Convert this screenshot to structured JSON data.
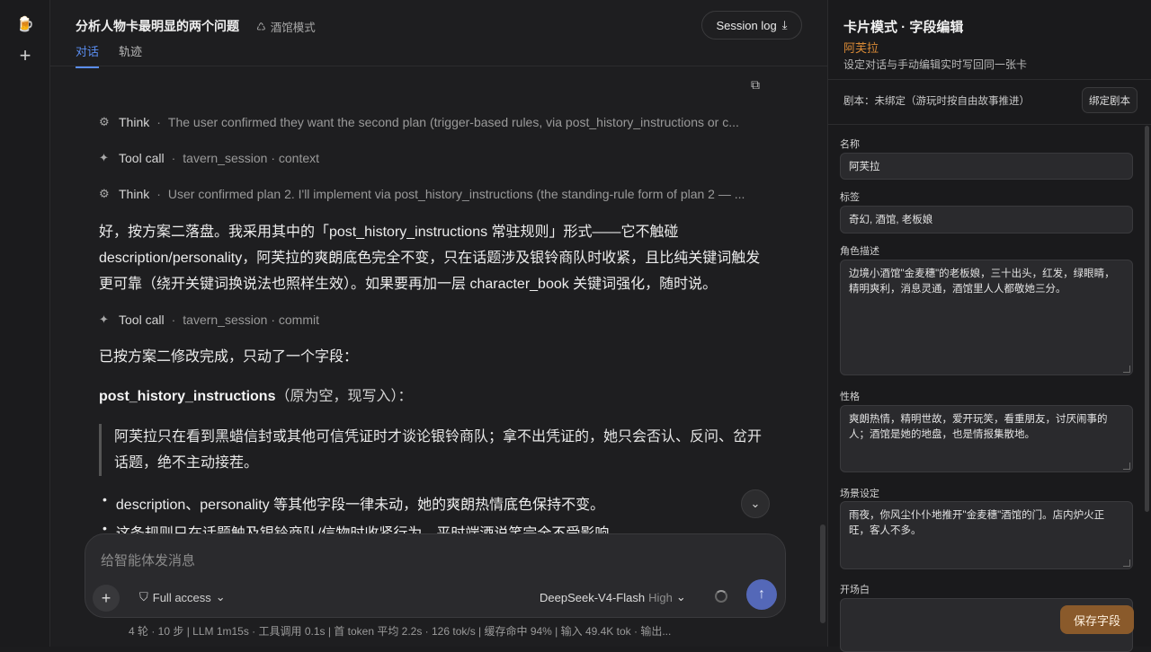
{
  "sidebar": {
    "logo_icon": "beer-mug-icon",
    "new_icon": "plus-icon"
  },
  "header": {
    "title": "分析人物卡最明显的两个问题",
    "mode_label": "酒馆模式",
    "session_button": "Session log",
    "tabs": [
      "对话",
      "轨迹"
    ]
  },
  "chat": {
    "think1": {
      "label": "Think",
      "sep": "·",
      "desc": "The user confirmed they want the second plan (trigger-based rules, via post_history_instructions or c..."
    },
    "tool1": {
      "label": "Tool call",
      "sep": "·",
      "desc": "tavern_session · context"
    },
    "think2": {
      "label": "Think",
      "sep": "·",
      "desc": "User confirmed plan 2. I'll implement via post_history_instructions (the standing-rule form of plan 2 — ..."
    },
    "para1": "好，按方案二落盘。我采用其中的「post_history_instructions 常驻规则」形式——它不触碰 description/personality，阿芙拉的爽朗底色完全不变，只在话题涉及银铃商队时收紧，且比纯关键词触发更可靠（绕开关键词换说法也照样生效）。如果要再加一层 character_book 关键词强化，随时说。",
    "tool2": {
      "label": "Tool call",
      "sep": "·",
      "desc": "tavern_session · commit"
    },
    "para2": "已按方案二修改完成，只动了一个字段：",
    "field_name": "post_history_instructions",
    "field_note": "（原为空，现写入）：",
    "quote": "阿芙拉只在看到黑蜡信封或其他可信凭证时才谈论银铃商队；拿不出凭证的，她只会否认、反问、岔开话题，绝不主动接茬。",
    "bullet1": "description、personality 等其他字段一律未动，她的爽朗热情底色保持不变。",
    "bullet2": "这条规则只在话题触及银铃商队/信物时收紧行为，平时端酒说笑完全不受影响。"
  },
  "composer": {
    "placeholder": "给智能体发消息",
    "access": "Full access",
    "model": "DeepSeek-V4-Flash",
    "level": "High"
  },
  "status": "4 轮 · 10 步   |   LLM 1m15s · 工具调用 0.1s   |   首 token 平均 2.2s · 126 tok/s   |   缓存命中 94%   |   输入 49.4K tok · 输出...",
  "panel": {
    "title": "卡片模式 · 字段编辑",
    "name": "阿芙拉",
    "subtitle": "设定对话与手动编辑实时写回同一张卡",
    "script": "剧本：未绑定（游玩时按自由故事推进）",
    "bind_button": "绑定剧本",
    "fields": {
      "name_label": "名称",
      "name_value": "阿芙拉",
      "tags_label": "标签",
      "tags_value": "奇幻, 酒馆, 老板娘",
      "desc_label": "角色描述",
      "desc_value": "边境小酒馆\"金麦穗\"的老板娘，三十出头，红发，绿眼睛，精明爽利，消息灵通，酒馆里人人都敬她三分。",
      "pers_label": "性格",
      "pers_value": "爽朗热情，精明世故，爱开玩笑，看重朋友，讨厌闹事的人；酒馆是她的地盘，也是情报集散地。",
      "scene_label": "场景设定",
      "scene_value": "雨夜，你风尘仆仆地推开\"金麦穗\"酒馆的门。店内炉火正旺，客人不多。",
      "open_label": "开场白"
    },
    "save_button": "保存字段"
  }
}
